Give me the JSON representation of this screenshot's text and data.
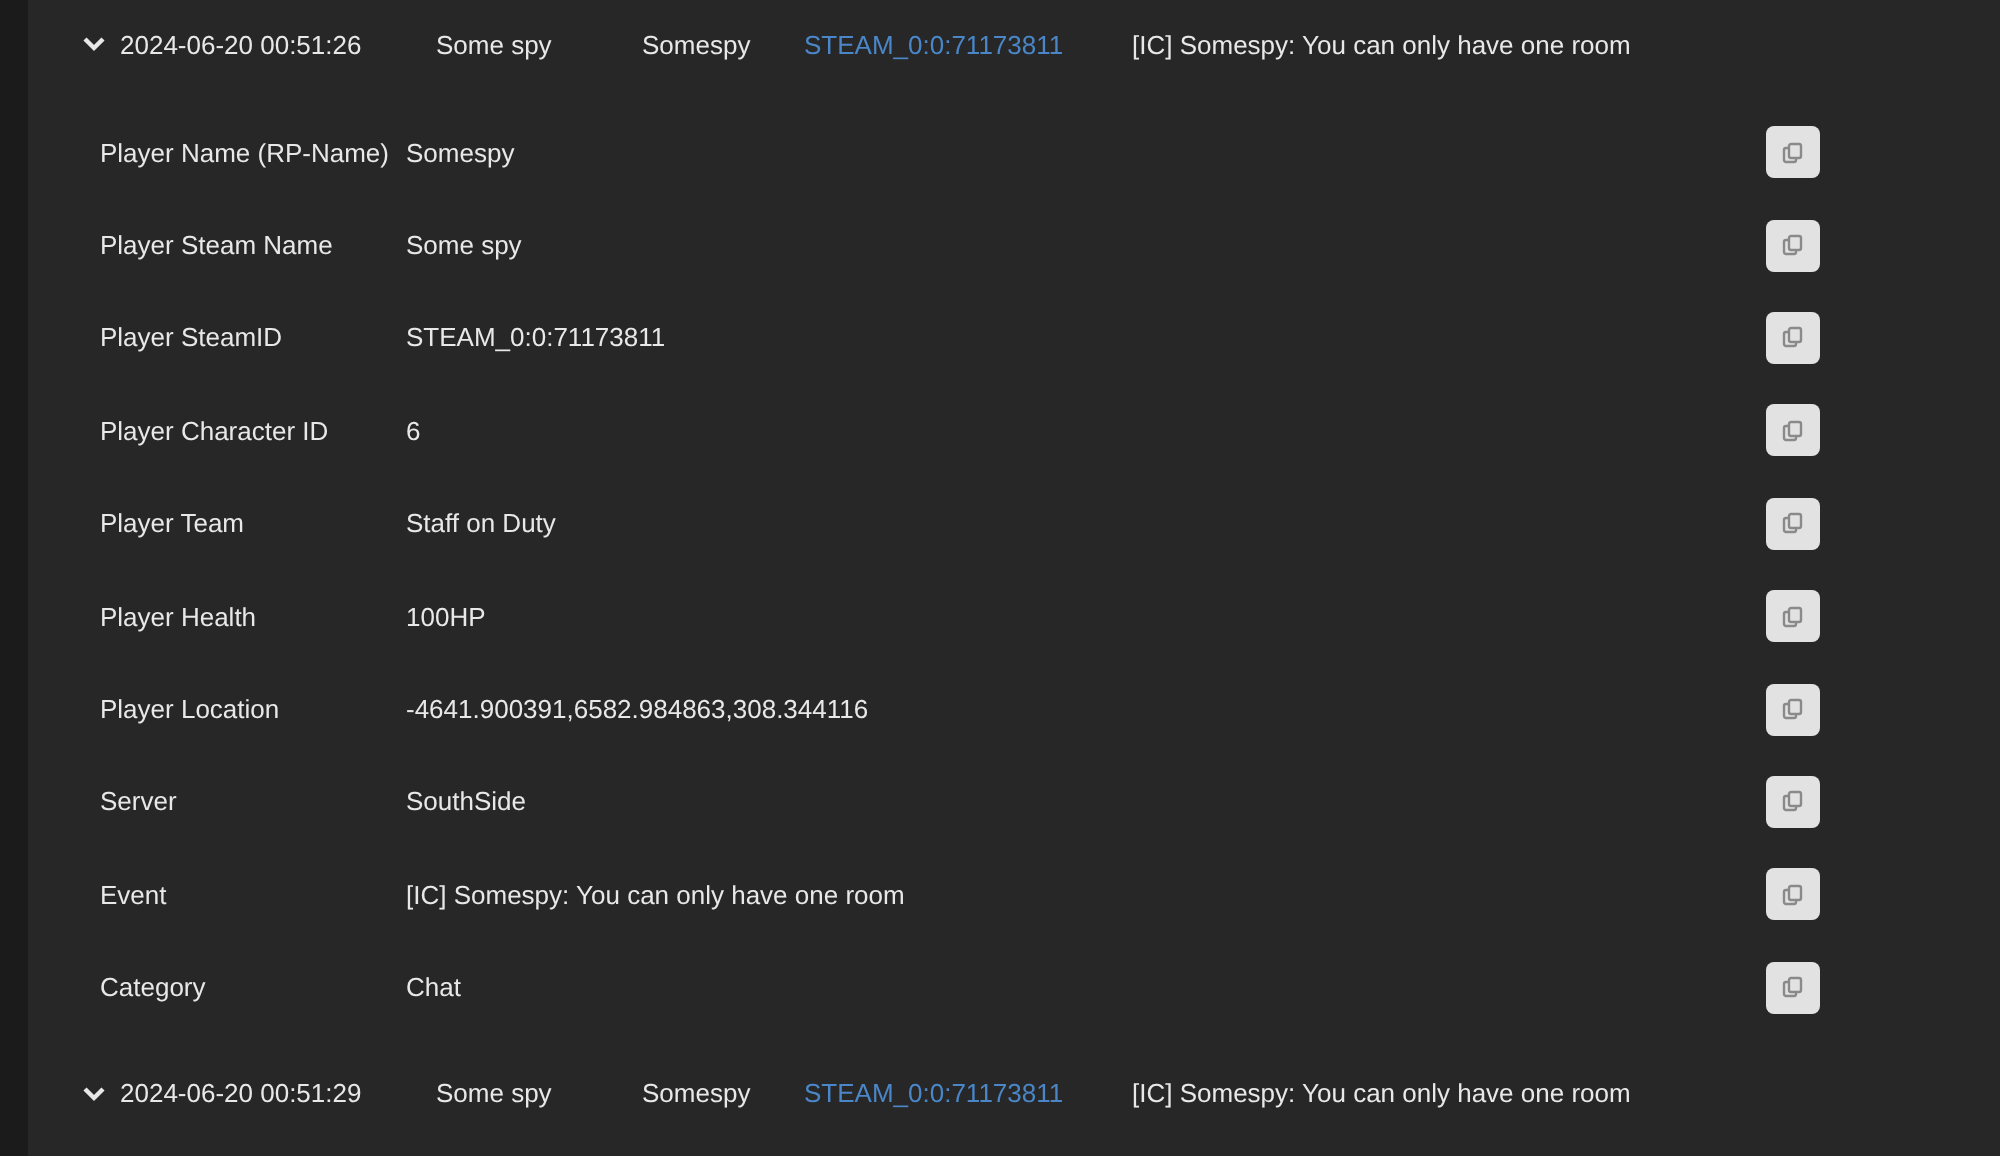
{
  "entries": [
    {
      "expanded": true,
      "time": "2024-06-20 00:51:26",
      "steam_name": "Some spy",
      "rp_name": "Somespy",
      "steam_id": "STEAM_0:0:71173811",
      "event": "[IC] Somespy: You can only have one room",
      "details": [
        {
          "label": "Player Name (RP-Name)",
          "value": "Somespy"
        },
        {
          "label": "Player Steam Name",
          "value": "Some spy"
        },
        {
          "label": "Player SteamID",
          "value": "STEAM_0:0:71173811"
        },
        {
          "label": "Player Character ID",
          "value": "6"
        },
        {
          "label": "Player Team",
          "value": "Staff on Duty"
        },
        {
          "label": "Player Health",
          "value": "100HP"
        },
        {
          "label": "Player Location",
          "value": "-4641.900391,6582.984863,308.344116"
        },
        {
          "label": "Server",
          "value": "SouthSide"
        },
        {
          "label": "Event",
          "value": "[IC] Somespy: You can only have one room"
        },
        {
          "label": "Category",
          "value": "Chat"
        }
      ]
    },
    {
      "expanded": true,
      "time": "2024-06-20 00:51:29",
      "steam_name": "Some spy",
      "rp_name": "Somespy",
      "steam_id": "STEAM_0:0:71173811",
      "event": "[IC] Somespy: You can only have one room"
    }
  ]
}
